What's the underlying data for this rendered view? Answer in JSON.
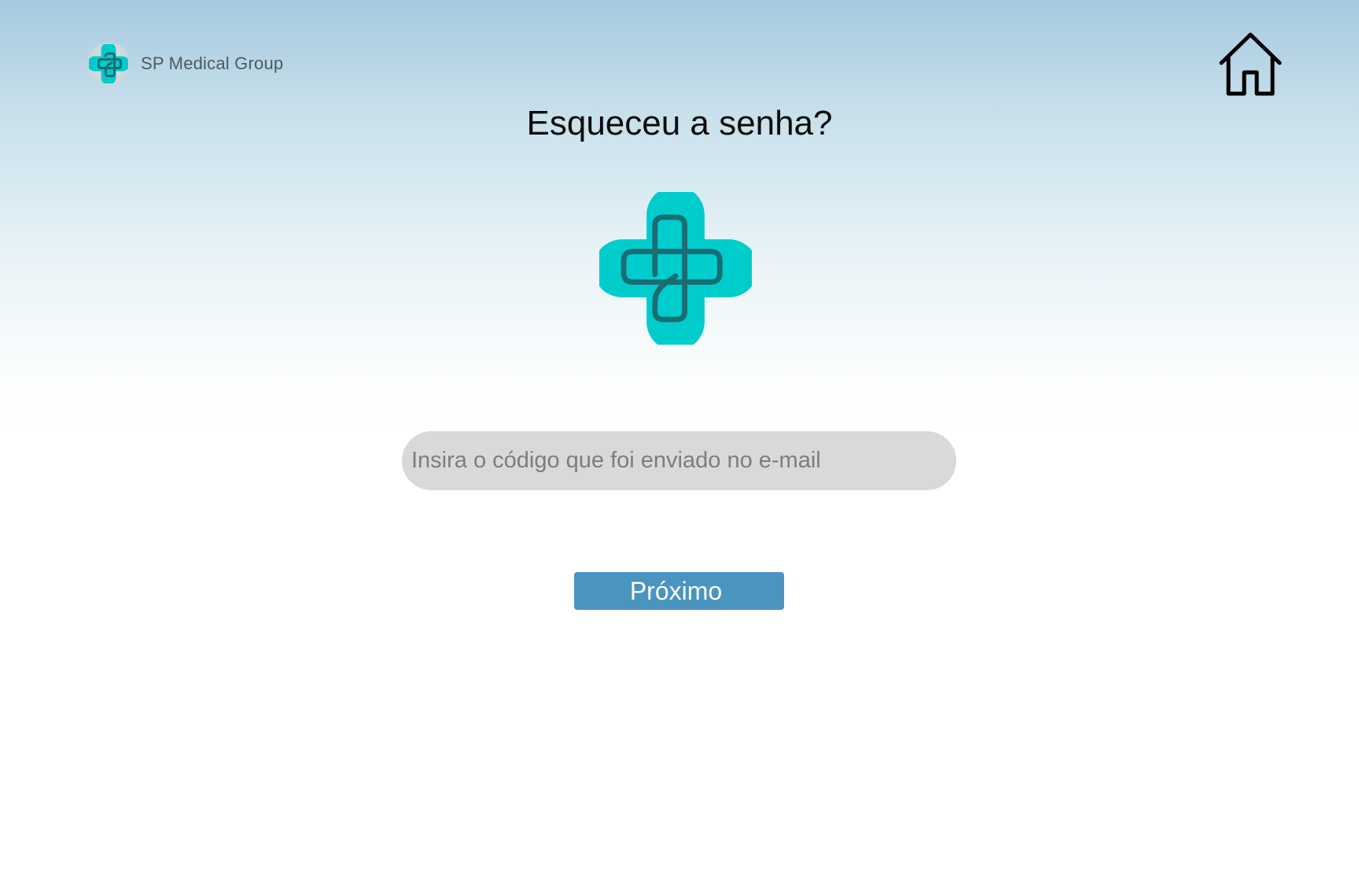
{
  "header": {
    "brand_name": "SP Medical Group",
    "logo_icon": "medical-cross-logo-icon",
    "home_icon": "home-icon"
  },
  "main": {
    "title": "Esqueceu a senha?",
    "hero_icon": "medical-cross-logo-icon",
    "code_field": {
      "placeholder": "Insira o código que foi enviado no e-mail",
      "value": ""
    },
    "next_button_label": "Próximo"
  },
  "colors": {
    "brand_teal": "#00cccc",
    "brand_teal_dark": "#1a6d73",
    "button_blue": "#4a94c0",
    "input_gray": "#d9d9d9",
    "header_gradient_top": "#a6c9df"
  }
}
